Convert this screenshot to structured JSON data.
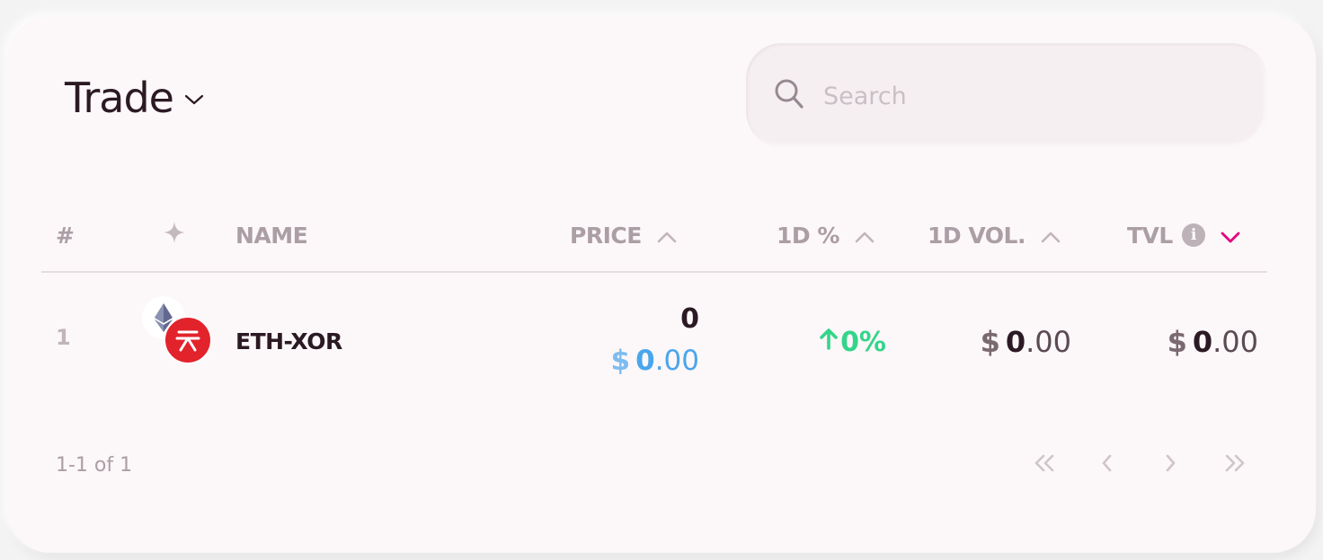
{
  "header": {
    "title": "Trade"
  },
  "search": {
    "placeholder": "Search",
    "value": ""
  },
  "table": {
    "columns": {
      "index": "#",
      "name": "NAME",
      "price": "PRICE",
      "change": "1D %",
      "volume": "1D VOL.",
      "tvl": "TVL"
    },
    "info_glyph": "i",
    "rows": [
      {
        "index": "1",
        "pair": "ETH-XOR",
        "price": "0",
        "price_usd_symbol": "$",
        "price_usd_int": "0",
        "price_usd_dec": ".00",
        "change": "0%",
        "volume_symbol": "$",
        "volume_int": "0",
        "volume_dec": ".00",
        "tvl_symbol": "$",
        "tvl_int": "0",
        "tvl_dec": ".00"
      }
    ]
  },
  "pagination": {
    "info": "1-1 of 1"
  },
  "colors": {
    "accent": "#e3007d",
    "positive": "#34d58a",
    "usd_blue": "#4aa6ec",
    "xor_red": "#e3232c"
  },
  "icons": [
    "chevron-down-icon",
    "search-icon",
    "sparkle-icon",
    "sort-up-icon",
    "info-icon",
    "sort-down-icon",
    "eth-icon",
    "xor-icon",
    "arrow-up-icon",
    "first-page-icon",
    "prev-page-icon",
    "next-page-icon",
    "last-page-icon"
  ]
}
